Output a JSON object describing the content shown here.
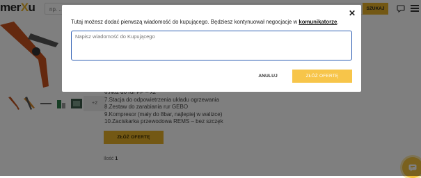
{
  "header": {
    "logo_left": "mer",
    "logo_x": "X",
    "logo_right": "u",
    "search_placeholder": "np. ...",
    "search_button": "SZUKAJ"
  },
  "gallery": {
    "more_label": "+2"
  },
  "specs": [
    "6.Nóż do rur PP – x2",
    "7.Stacja do odpowietrzenia układu ogrzewania",
    "8.Zestaw do zarabiania rur GEBO",
    "9.Kompresor (mały do 8bar, najlepiej w walizce)",
    "10.Zaciskarka przewodowa REMS – bez szczęk"
  ],
  "product": {
    "offer_button": "ZŁÓŻ OFERTĘ",
    "qty_label": "Ilość",
    "qty_value": "1"
  },
  "modal": {
    "text_before": "Tutaj możesz dodać pierwszą wiadomość do kupującego. Będziesz kontynuował negocjacje w ",
    "text_link": "komunikatorze",
    "text_after": ".",
    "message_placeholder": "Napisz wiadomość do Kupującego",
    "cancel_label": "ANULUJ",
    "submit_label": "ZŁÓŻ OFERTĘ",
    "close_icon": "close-icon"
  },
  "colors": {
    "accent": "#e7b128",
    "submit_disabled": "#f7c54a",
    "input_border": "#2f5fb3"
  }
}
